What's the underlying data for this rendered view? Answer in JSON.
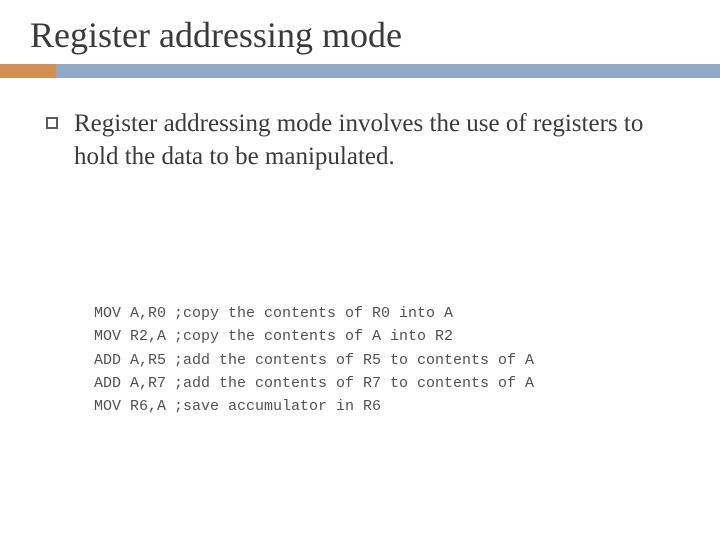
{
  "title": "Register addressing mode",
  "bullet": "Register addressing mode involves the use of registers to hold the data to be manipulated.",
  "code": [
    {
      "instr": "MOV A,R0",
      "comment": ";copy the contents of R0 into A"
    },
    {
      "instr": "MOV R2,A",
      "comment": ";copy the contents of A into R2"
    },
    {
      "instr": "ADD A,R5",
      "comment": ";add the contents of R5 to contents of A"
    },
    {
      "instr": "ADD A,R7",
      "comment": ";add the contents of R7 to contents of A"
    },
    {
      "instr": "MOV R6,A",
      "comment": ";save accumulator in R6"
    }
  ]
}
